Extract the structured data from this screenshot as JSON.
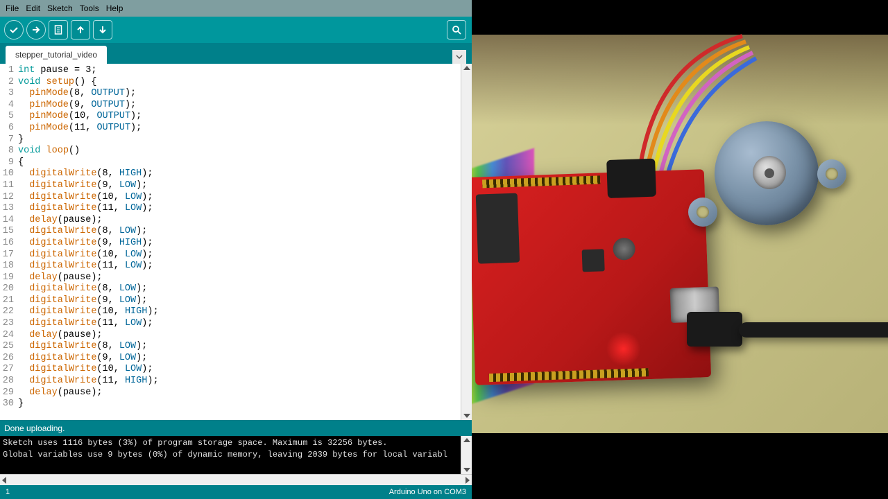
{
  "menu": {
    "file": "File",
    "edit": "Edit",
    "sketch": "Sketch",
    "tools": "Tools",
    "help": "Help"
  },
  "toolbar": {
    "verify": "Verify",
    "upload": "Upload",
    "new": "New",
    "open": "Open",
    "save": "Save",
    "serial": "Serial Monitor"
  },
  "tab": "stepper_tutorial_video",
  "code": [
    {
      "n": 1,
      "tokens": [
        [
          "kw",
          "int"
        ],
        [
          "",
          " pause = "
        ],
        [
          "",
          "3"
        ],
        [
          "",
          ";"
        ]
      ]
    },
    {
      "n": 2,
      "tokens": [
        [
          "kw",
          "void"
        ],
        [
          "",
          " "
        ],
        [
          "fn",
          "setup"
        ],
        [
          "",
          "() {"
        ]
      ]
    },
    {
      "n": 3,
      "tokens": [
        [
          "",
          "  "
        ],
        [
          "fn",
          "pinMode"
        ],
        [
          "",
          "(8, "
        ],
        [
          "cn",
          "OUTPUT"
        ],
        [
          "",
          ");"
        ]
      ]
    },
    {
      "n": 4,
      "tokens": [
        [
          "",
          "  "
        ],
        [
          "fn",
          "pinMode"
        ],
        [
          "",
          "(9, "
        ],
        [
          "cn",
          "OUTPUT"
        ],
        [
          "",
          ");"
        ]
      ]
    },
    {
      "n": 5,
      "tokens": [
        [
          "",
          "  "
        ],
        [
          "fn",
          "pinMode"
        ],
        [
          "",
          "(10, "
        ],
        [
          "cn",
          "OUTPUT"
        ],
        [
          "",
          ");"
        ]
      ]
    },
    {
      "n": 6,
      "tokens": [
        [
          "",
          "  "
        ],
        [
          "fn",
          "pinMode"
        ],
        [
          "",
          "(11, "
        ],
        [
          "cn",
          "OUTPUT"
        ],
        [
          "",
          ");"
        ]
      ]
    },
    {
      "n": 7,
      "tokens": [
        [
          "",
          "}"
        ]
      ]
    },
    {
      "n": 8,
      "tokens": [
        [
          "kw",
          "void"
        ],
        [
          "",
          " "
        ],
        [
          "fn",
          "loop"
        ],
        [
          "",
          "()"
        ]
      ]
    },
    {
      "n": 9,
      "tokens": [
        [
          "",
          "{"
        ]
      ]
    },
    {
      "n": 10,
      "tokens": [
        [
          "",
          "  "
        ],
        [
          "fn",
          "digitalWrite"
        ],
        [
          "",
          "(8, "
        ],
        [
          "cn",
          "HIGH"
        ],
        [
          "",
          ");"
        ]
      ]
    },
    {
      "n": 11,
      "tokens": [
        [
          "",
          "  "
        ],
        [
          "fn",
          "digitalWrite"
        ],
        [
          "",
          "(9, "
        ],
        [
          "cn",
          "LOW"
        ],
        [
          "",
          ");"
        ]
      ]
    },
    {
      "n": 12,
      "tokens": [
        [
          "",
          "  "
        ],
        [
          "fn",
          "digitalWrite"
        ],
        [
          "",
          "(10, "
        ],
        [
          "cn",
          "LOW"
        ],
        [
          "",
          ");"
        ]
      ]
    },
    {
      "n": 13,
      "tokens": [
        [
          "",
          "  "
        ],
        [
          "fn",
          "digitalWrite"
        ],
        [
          "",
          "(11, "
        ],
        [
          "cn",
          "LOW"
        ],
        [
          "",
          ");"
        ]
      ]
    },
    {
      "n": 14,
      "tokens": [
        [
          "",
          "  "
        ],
        [
          "fn",
          "delay"
        ],
        [
          "",
          "(pause);"
        ]
      ]
    },
    {
      "n": 15,
      "tokens": [
        [
          "",
          "  "
        ],
        [
          "fn",
          "digitalWrite"
        ],
        [
          "",
          "(8, "
        ],
        [
          "cn",
          "LOW"
        ],
        [
          "",
          ");"
        ]
      ]
    },
    {
      "n": 16,
      "tokens": [
        [
          "",
          "  "
        ],
        [
          "fn",
          "digitalWrite"
        ],
        [
          "",
          "(9, "
        ],
        [
          "cn",
          "HIGH"
        ],
        [
          "",
          ");"
        ]
      ]
    },
    {
      "n": 17,
      "tokens": [
        [
          "",
          "  "
        ],
        [
          "fn",
          "digitalWrite"
        ],
        [
          "",
          "(10, "
        ],
        [
          "cn",
          "LOW"
        ],
        [
          "",
          ");"
        ]
      ]
    },
    {
      "n": 18,
      "tokens": [
        [
          "",
          "  "
        ],
        [
          "fn",
          "digitalWrite"
        ],
        [
          "",
          "(11, "
        ],
        [
          "cn",
          "LOW"
        ],
        [
          "",
          ");"
        ]
      ]
    },
    {
      "n": 19,
      "tokens": [
        [
          "",
          "  "
        ],
        [
          "fn",
          "delay"
        ],
        [
          "",
          "(pause);"
        ]
      ]
    },
    {
      "n": 20,
      "tokens": [
        [
          "",
          "  "
        ],
        [
          "fn",
          "digitalWrite"
        ],
        [
          "",
          "(8, "
        ],
        [
          "cn",
          "LOW"
        ],
        [
          "",
          ");"
        ]
      ]
    },
    {
      "n": 21,
      "tokens": [
        [
          "",
          "  "
        ],
        [
          "fn",
          "digitalWrite"
        ],
        [
          "",
          "(9, "
        ],
        [
          "cn",
          "LOW"
        ],
        [
          "",
          ");"
        ]
      ]
    },
    {
      "n": 22,
      "tokens": [
        [
          "",
          "  "
        ],
        [
          "fn",
          "digitalWrite"
        ],
        [
          "",
          "(10, "
        ],
        [
          "cn",
          "HIGH"
        ],
        [
          "",
          ");"
        ]
      ]
    },
    {
      "n": 23,
      "tokens": [
        [
          "",
          "  "
        ],
        [
          "fn",
          "digitalWrite"
        ],
        [
          "",
          "(11, "
        ],
        [
          "cn",
          "LOW"
        ],
        [
          "",
          ");"
        ]
      ]
    },
    {
      "n": 24,
      "tokens": [
        [
          "",
          "  "
        ],
        [
          "fn",
          "delay"
        ],
        [
          "",
          "(pause);"
        ]
      ]
    },
    {
      "n": 25,
      "tokens": [
        [
          "",
          "  "
        ],
        [
          "fn",
          "digitalWrite"
        ],
        [
          "",
          "(8, "
        ],
        [
          "cn",
          "LOW"
        ],
        [
          "",
          ");"
        ]
      ]
    },
    {
      "n": 26,
      "tokens": [
        [
          "",
          "  "
        ],
        [
          "fn",
          "digitalWrite"
        ],
        [
          "",
          "(9, "
        ],
        [
          "cn",
          "LOW"
        ],
        [
          "",
          ");"
        ]
      ]
    },
    {
      "n": 27,
      "tokens": [
        [
          "",
          "  "
        ],
        [
          "fn",
          "digitalWrite"
        ],
        [
          "",
          "(10, "
        ],
        [
          "cn",
          "LOW"
        ],
        [
          "",
          ");"
        ]
      ]
    },
    {
      "n": 28,
      "tokens": [
        [
          "",
          "  "
        ],
        [
          "fn",
          "digitalWrite"
        ],
        [
          "",
          "(11, "
        ],
        [
          "cn",
          "HIGH"
        ],
        [
          "",
          ");"
        ]
      ]
    },
    {
      "n": 29,
      "tokens": [
        [
          "",
          "  "
        ],
        [
          "fn",
          "delay"
        ],
        [
          "",
          "(pause);"
        ]
      ]
    },
    {
      "n": 30,
      "tokens": [
        [
          "",
          "}"
        ]
      ]
    }
  ],
  "status": "Done uploading.",
  "console": [
    "Sketch uses 1116 bytes (3%) of program storage space. Maximum is 32256 bytes.",
    "Global variables use 9 bytes (0%) of dynamic memory, leaving 2039 bytes for local variabl"
  ],
  "footer": {
    "left": "1",
    "right": "Arduino Uno on COM3"
  }
}
